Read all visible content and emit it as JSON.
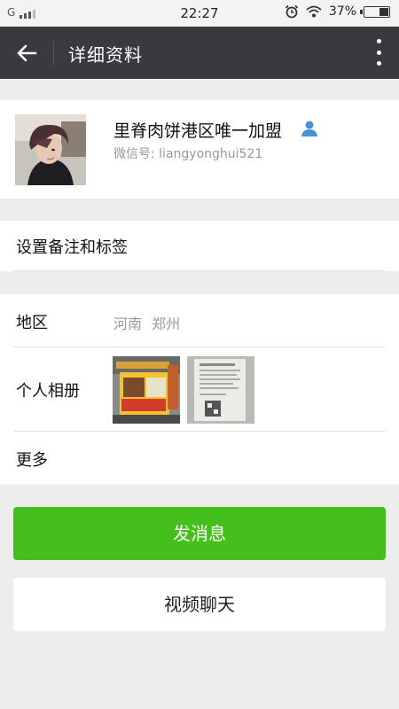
{
  "status_bar": {
    "carrier": "G",
    "time": "22:27",
    "battery": "37%",
    "battery_level": 0.37,
    "icons": [
      "signal-icon",
      "alarm-icon",
      "wifi-icon",
      "battery-icon"
    ]
  },
  "header": {
    "title": "详细资料",
    "back_icon": "arrow-left-icon",
    "more_icon": "more-vertical-icon"
  },
  "profile": {
    "name": "里脊肉饼港区唯一加盟",
    "wechat_id": "微信号: liangyonghui521",
    "badge_icon": "person-icon"
  },
  "remark": {
    "label": "设置备注和标签"
  },
  "details": {
    "region_label": "地区",
    "region_value": "河南  郑州",
    "album_label": "个人相册",
    "more_label": "更多"
  },
  "actions": {
    "send_message": "发消息",
    "video_chat": "视频聊天"
  },
  "colors": {
    "header_bg": "#393a3f",
    "primary_green": "#44bf1e",
    "page_bg": "#ededed"
  }
}
